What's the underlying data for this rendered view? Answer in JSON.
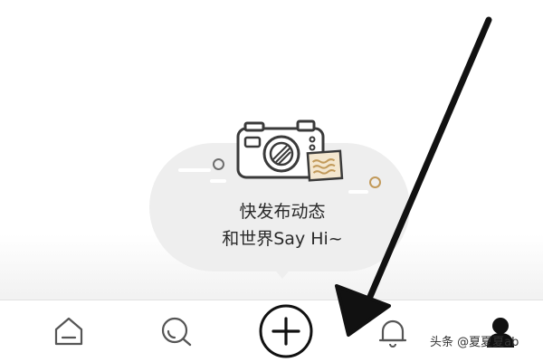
{
  "empty_state": {
    "title": "快发布动态",
    "subtitle": "和世界Say Hi~",
    "illustration": "camera-icon",
    "colors": {
      "bubble": "#eeeeee",
      "accent": "#c29a5a"
    }
  },
  "tab_bar": {
    "items": [
      {
        "icon": "home-icon"
      },
      {
        "icon": "discover-icon"
      },
      {
        "icon": "add-post-icon"
      },
      {
        "icon": "notification-bell-icon"
      },
      {
        "icon": "profile-icon"
      }
    ]
  },
  "overlay": {
    "annotation": "arrow pointing to add-post button",
    "color": "#111111"
  },
  "watermark": "头条 @夏夏夏ab"
}
